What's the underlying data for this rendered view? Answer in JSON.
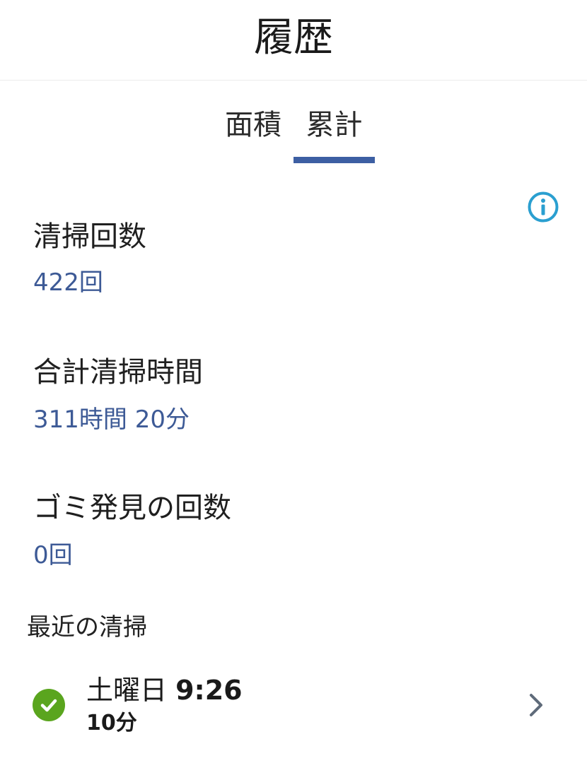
{
  "header": {
    "title": "履歴"
  },
  "tabs": [
    {
      "label": "面積",
      "selected": false
    },
    {
      "label": "累計",
      "selected": true
    }
  ],
  "colors": {
    "accent": "#3d5fa3",
    "value_text": "#3d5a96",
    "info_icon": "#2a9fd0",
    "success": "#5aa51e"
  },
  "icons": {
    "info": "info-circle-icon",
    "status": "check-circle-icon",
    "row_action": "chevron-right-icon"
  },
  "stats": {
    "count": {
      "label": "清掃回数",
      "value": "422回"
    },
    "total_time": {
      "label": "合計清掃時間",
      "value": "311時間 20分"
    },
    "dust_found": {
      "label": "ゴミ発見の回数",
      "value": "0回"
    }
  },
  "recent": {
    "heading": "最近の清掃",
    "items": [
      {
        "day": "土曜日",
        "time": "9:26",
        "duration": "10分",
        "status": "completed"
      }
    ]
  }
}
